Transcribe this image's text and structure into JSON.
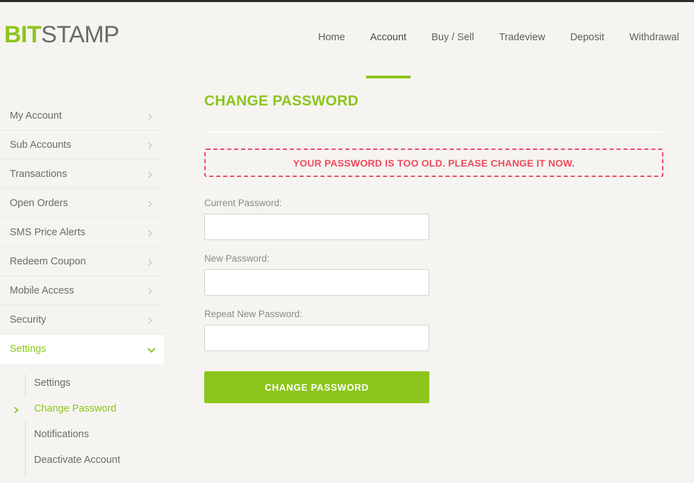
{
  "brand": {
    "name_part1": "BIT",
    "name_part2": "STAMP",
    "accent_color": "#8cc51c",
    "logo_gray": "#6a6a6a"
  },
  "topnav": {
    "items": [
      {
        "label": "Home",
        "active": false
      },
      {
        "label": "Account",
        "active": true
      },
      {
        "label": "Buy / Sell",
        "active": false
      },
      {
        "label": "Tradeview",
        "active": false
      },
      {
        "label": "Deposit",
        "active": false
      },
      {
        "label": "Withdrawal",
        "active": false
      }
    ]
  },
  "sidebar": {
    "items": [
      {
        "label": "My Account",
        "icon": "chevron-right-icon"
      },
      {
        "label": "Sub Accounts",
        "icon": "chevron-right-icon"
      },
      {
        "label": "Transactions",
        "icon": "chevron-right-icon"
      },
      {
        "label": "Open Orders",
        "icon": "chevron-right-icon"
      },
      {
        "label": "SMS Price Alerts",
        "icon": "chevron-right-icon"
      },
      {
        "label": "Redeem Coupon",
        "icon": "chevron-right-icon"
      },
      {
        "label": "Mobile Access",
        "icon": "chevron-right-icon"
      },
      {
        "label": "Security",
        "icon": "chevron-right-icon"
      }
    ],
    "expanded": {
      "label": "Settings",
      "icon": "chevron-down-icon"
    },
    "subitems": [
      {
        "label": "Settings",
        "active": false
      },
      {
        "label": "Change Password",
        "active": true
      },
      {
        "label": "Notifications",
        "active": false
      },
      {
        "label": "Deactivate Account",
        "active": false
      }
    ]
  },
  "main": {
    "title": "CHANGE PASSWORD",
    "alert": {
      "text": "YOUR PASSWORD IS TOO OLD. PLEASE CHANGE IT NOW.",
      "color": "#f2495c"
    },
    "fields": [
      {
        "label": "Current Password:",
        "value": "",
        "placeholder": ""
      },
      {
        "label": "New Password:",
        "value": "",
        "placeholder": ""
      },
      {
        "label": "Repeat New Password:",
        "value": "",
        "placeholder": ""
      }
    ],
    "submit_label": "CHANGE PASSWORD"
  }
}
